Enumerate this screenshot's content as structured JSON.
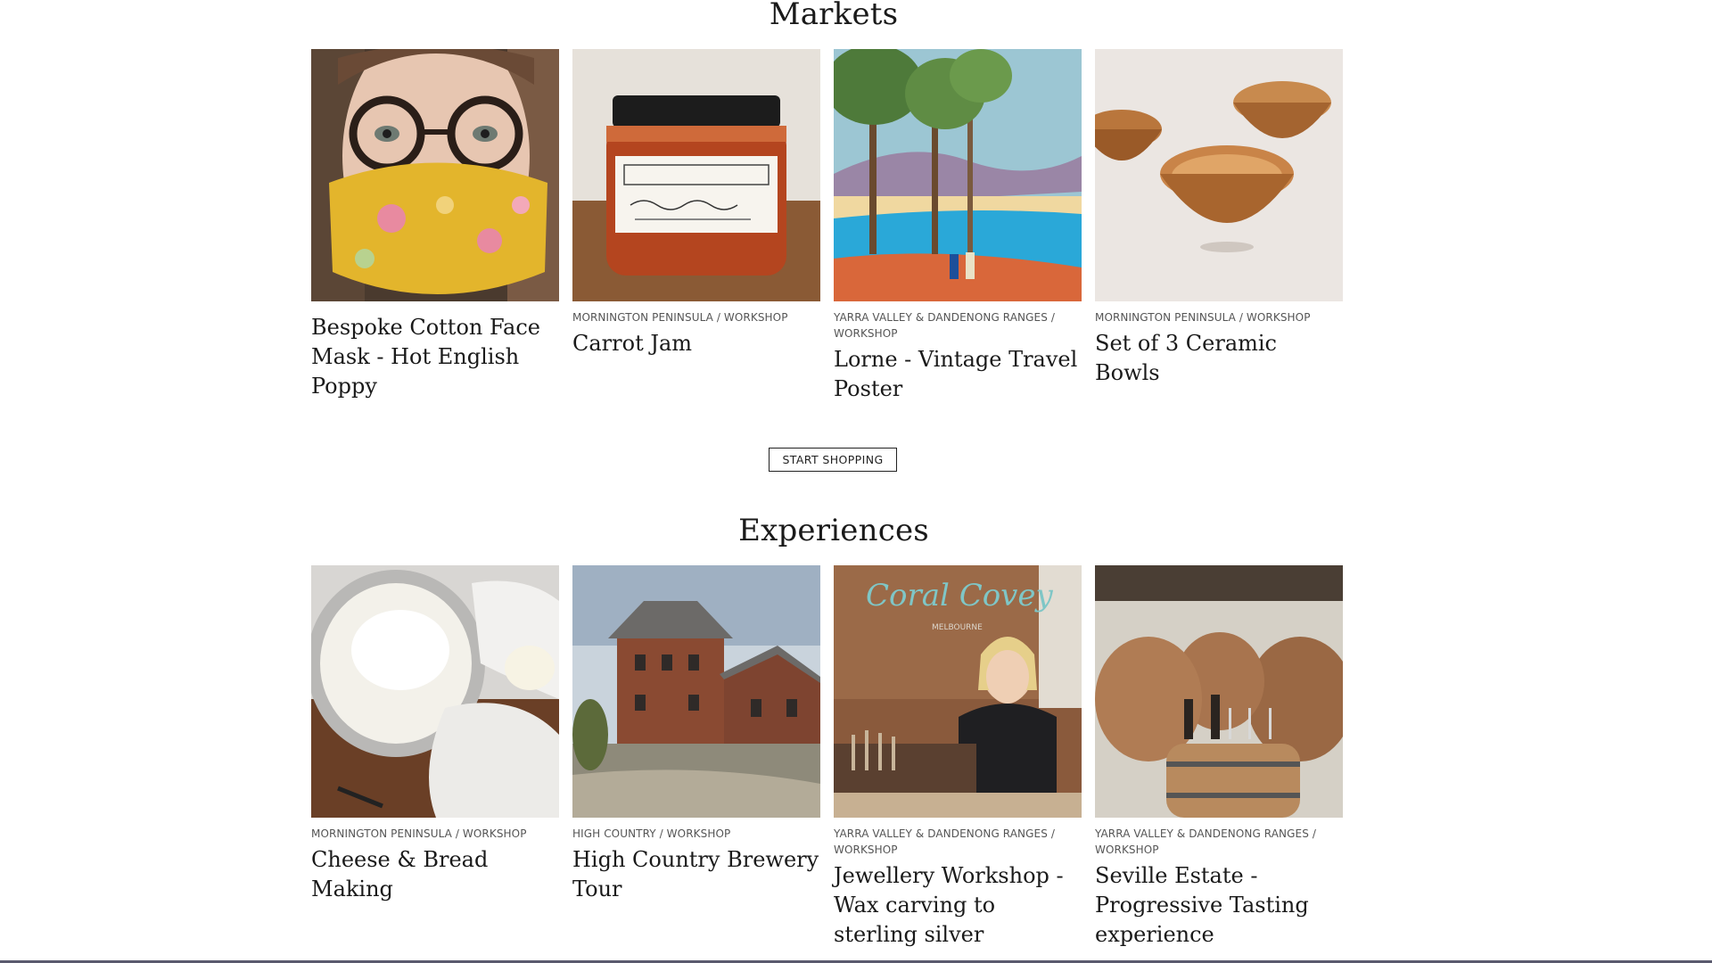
{
  "markets": {
    "title": "Markets",
    "cta": "START SHOPPING",
    "items": [
      {
        "meta": "",
        "title": "Bespoke Cotton Face Mask - Hot English Poppy",
        "image": "face-mask-photo"
      },
      {
        "meta": "MORNINGTON PENINSULA / WORKSHOP",
        "title": "Carrot Jam",
        "image": "carrot-jam-jar-photo"
      },
      {
        "meta": "YARRA VALLEY & DANDENONG RANGES / WORKSHOP",
        "title": "Lorne - Vintage Travel Poster",
        "image": "vintage-poster-image"
      },
      {
        "meta": "MORNINGTON PENINSULA / WORKSHOP",
        "title": "Set of 3 Ceramic Bowls",
        "image": "ceramic-bowls-photo"
      }
    ]
  },
  "experiences": {
    "title": "Experiences",
    "items": [
      {
        "meta": "MORNINGTON PENINSULA / WORKSHOP",
        "title": "Cheese & Bread Making",
        "image": "cheese-making-photo"
      },
      {
        "meta": "HIGH COUNTRY / WORKSHOP",
        "title": "High Country Brewery Tour",
        "image": "brewery-building-photo"
      },
      {
        "meta": "YARRA VALLEY & DANDENONG RANGES / WORKSHOP",
        "title": "Jewellery Workshop - Wax carving to sterling silver",
        "image": "jewellery-workshop-photo",
        "sign_text": "Coral Covey",
        "sign_subtext": "MELBOURNE"
      },
      {
        "meta": "YARRA VALLEY & DANDENONG RANGES / WORKSHOP",
        "title": "Seville Estate - Progressive Tasting experience",
        "image": "wine-barrels-photo"
      }
    ]
  },
  "colors": {
    "text": "#1a1a1a",
    "meta": "#555555",
    "button_border": "#222222",
    "bottom_bar": "#5a5a6e"
  }
}
